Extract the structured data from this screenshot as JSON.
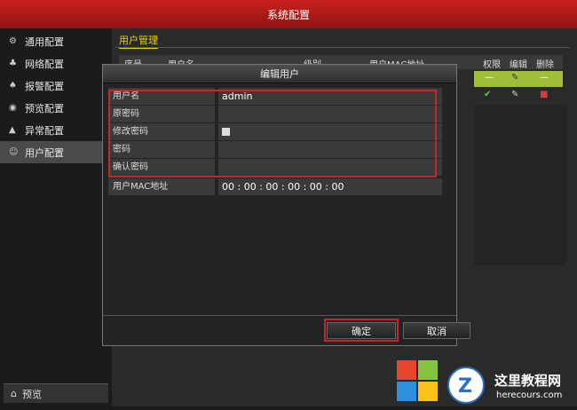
{
  "window_title": "系统配置",
  "sidebar": {
    "items": [
      {
        "icon": "gear-icon",
        "glyph": "⚙",
        "label": "通用配置"
      },
      {
        "icon": "network-icon",
        "glyph": "♣",
        "label": "网络配置"
      },
      {
        "icon": "alarm-icon",
        "glyph": "♠",
        "label": "报警配置"
      },
      {
        "icon": "eye-icon",
        "glyph": "◉",
        "label": "预览配置"
      },
      {
        "icon": "warning-icon",
        "glyph": "▲",
        "label": "异常配置"
      },
      {
        "icon": "user-icon",
        "glyph": "☺",
        "label": "用户配置"
      }
    ],
    "preview_label": "预览"
  },
  "main": {
    "tab_label": "用户管理",
    "table_headers": {
      "no": "序号",
      "username": "用户名",
      "level": "级别",
      "mac": "用户MAC地址",
      "perm": "权限",
      "edit": "编辑",
      "delete": "删除"
    },
    "row1": {
      "perm": "—",
      "delete": "—"
    }
  },
  "modal": {
    "title": "编辑用户",
    "fields": {
      "username_label": "用户名",
      "username_value": "admin",
      "old_password_label": "原密码",
      "change_password_label": "修改密码",
      "password_label": "密码",
      "confirm_password_label": "确认密码",
      "mac_label": "用户MAC地址",
      "mac_value": "00 : 00 : 00 : 00 : 00 : 00"
    },
    "ok_label": "确定",
    "cancel_label": "取消"
  },
  "watermark": {
    "text": "这里教程网",
    "url": "herecours.com"
  }
}
